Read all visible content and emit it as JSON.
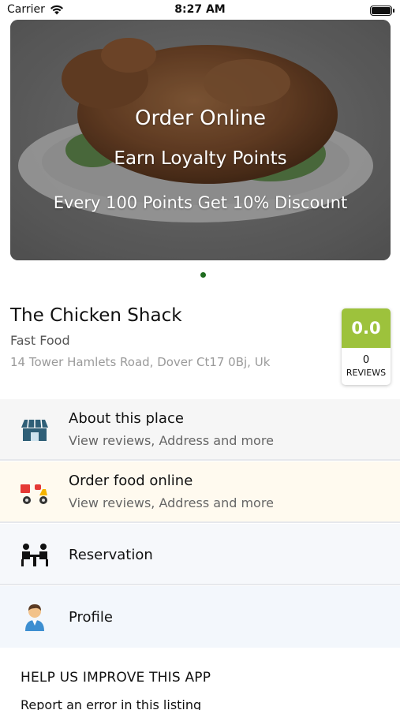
{
  "status_bar": {
    "carrier": "Carrier",
    "time": "8:27 AM"
  },
  "banner": {
    "line1": "Order Online",
    "line2": "Earn Loyalty Points",
    "line3": "Every 100 Points Get 10% Discount"
  },
  "restaurant": {
    "name": "The Chicken Shack",
    "type": "Fast Food",
    "address": "14 Tower Hamlets Road, Dover Ct17 0Bj, Uk",
    "rating": "0.0",
    "review_count": "0",
    "reviews_label": "REVIEWS",
    "rating_color": "#9dc23c"
  },
  "menu": {
    "about": {
      "title": "About this place",
      "subtitle": "View reviews, Address and more",
      "icon": "store-icon",
      "bg": "#f6f6f6"
    },
    "order": {
      "title": "Order food online",
      "subtitle": "View reviews, Address and more",
      "icon": "delivery-scooter-icon",
      "bg": "#fffaef"
    },
    "reservation": {
      "title": "Reservation",
      "icon": "dining-table-icon",
      "bg": "#f6f8fb"
    },
    "profile": {
      "title": "Profile",
      "icon": "user-profile-icon",
      "bg": "#f3f7fc"
    }
  },
  "help": {
    "title": "HELP US IMPROVE THIS APP",
    "report_link": "Report an error in this listing"
  },
  "colors": {
    "accent_green": "#1e6b1e",
    "store_blue": "#2f5f77"
  }
}
